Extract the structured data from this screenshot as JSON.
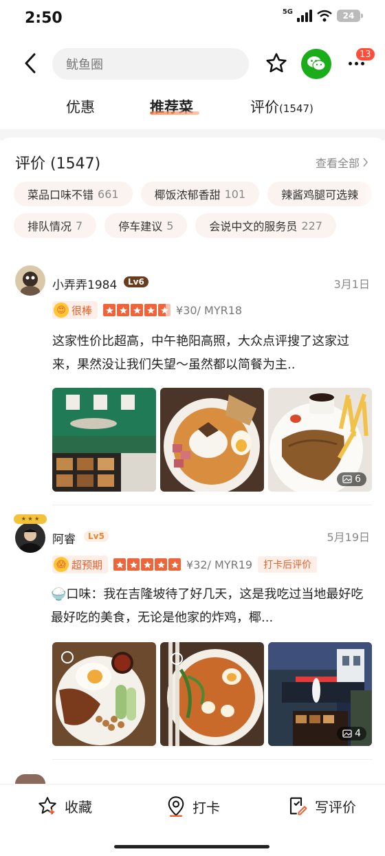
{
  "status": {
    "time": "2:50",
    "network": "5G",
    "battery": "24"
  },
  "header": {
    "search_placeholder": "鱿鱼圈",
    "notification_count": "13"
  },
  "tabs": [
    {
      "label": "优惠",
      "count": ""
    },
    {
      "label": "推荐菜",
      "count": ""
    },
    {
      "label": "评价",
      "count": "(1547)"
    }
  ],
  "reviews_section": {
    "title": "评价 (1547)",
    "see_all": "查看全部",
    "tags_row1": [
      {
        "label": "菜品口味不错",
        "count": "661"
      },
      {
        "label": "椰饭浓郁香甜",
        "count": "101"
      },
      {
        "label": "辣酱鸡腿可选辣",
        "count": ""
      }
    ],
    "tags_row2": [
      {
        "label": "排队情况",
        "count": "7"
      },
      {
        "label": "停车建议",
        "count": "5"
      },
      {
        "label": "会说中文的服务员",
        "count": "227"
      }
    ]
  },
  "reviews": [
    {
      "user": "小弄弄1984",
      "level": "Lv6",
      "date": "3月1日",
      "mood": "很棒",
      "stars": 4.5,
      "price": "¥30/ MYR18",
      "checkin": "",
      "text": "这家性价比超高，中午艳阳高照，大众点评搜了这家过来，果然没让我们失望～虽然都以简餐为主..",
      "photo_count": "6"
    },
    {
      "user": "阿睿",
      "level": "Lv5",
      "date": "5月19日",
      "mood": "超预期",
      "stars": 5,
      "price": "¥32/ MYR19",
      "checkin": "打卡后评价",
      "text": "🍚口味：我在吉隆坡待了好几天，这是我吃过当地最好吃最好吃的美食，无论是他家的炸鸡，椰...",
      "photo_count": "4"
    }
  ],
  "bottom_bar": {
    "favorite": "收藏",
    "checkin": "打卡",
    "write_review": "写评价"
  },
  "colors": {
    "accent": "#f0643a",
    "wechat": "#1aad19",
    "badge": "#ff4d3a"
  }
}
